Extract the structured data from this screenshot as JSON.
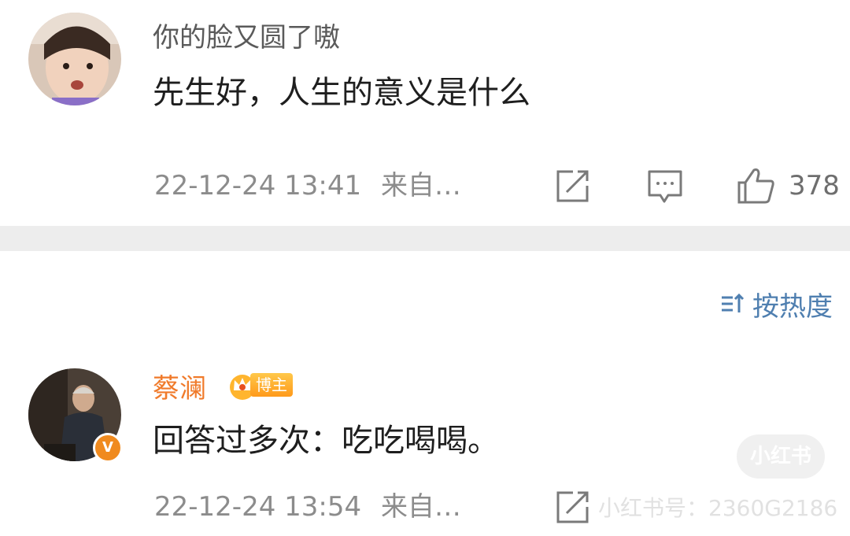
{
  "comments": [
    {
      "username": "你的脸又圆了嗷",
      "text": "先生好，人生的意义是什么",
      "time": "22-12-24 13:41",
      "source": "来自…",
      "likes": "378"
    },
    {
      "username": "蔡澜",
      "badge": "博主",
      "verified_mark": "V",
      "text": "回答过多次：吃吃喝喝。",
      "time": "22-12-24 13:54",
      "source": "来自…"
    }
  ],
  "sort": {
    "label": "按热度",
    "icon": "sort-icon"
  },
  "watermark": {
    "pill": "小红书",
    "line": "小红书号：2360G2186"
  },
  "colors": {
    "username_gray": "#5a5a5a",
    "blogger_name": "#f07a2a",
    "sort_blue": "#4f7fb0",
    "meta_gray": "#8c8c8c",
    "divider": "#ededed"
  }
}
